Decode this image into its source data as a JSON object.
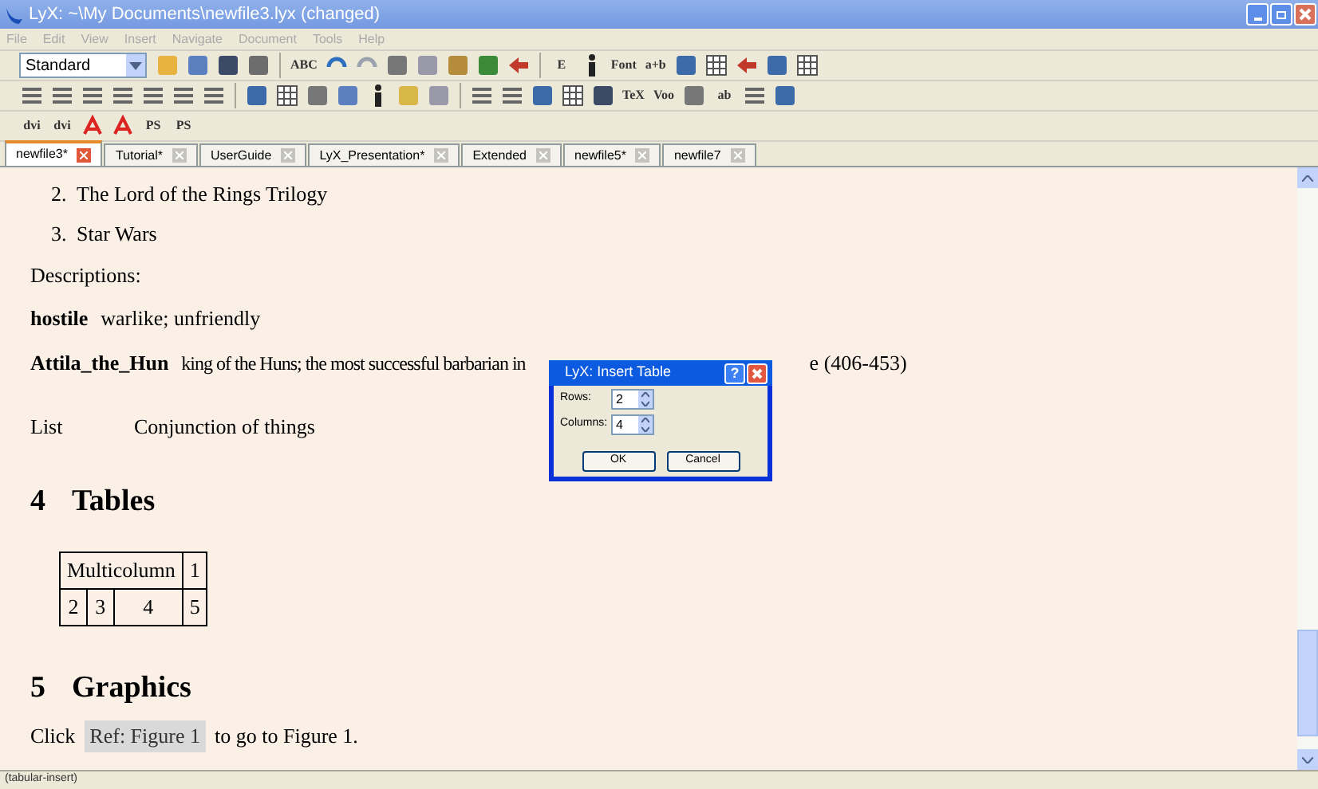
{
  "window": {
    "title": "LyX: ~\\My Documents\\newfile3.lyx (changed)"
  },
  "menu": [
    "File",
    "Edit",
    "View",
    "Insert",
    "Navigate",
    "Document",
    "Tools",
    "Help"
  ],
  "toolbars": [
    [
      {
        "kind": "combo",
        "label": "Standard"
      },
      {
        "kind": "icon"
      },
      {
        "kind": "icon"
      },
      {
        "kind": "icon"
      },
      {
        "kind": "icon"
      },
      {
        "kind": "sep"
      },
      {
        "kind": "label",
        "label": "ABC"
      },
      {
        "kind": "icon"
      },
      {
        "kind": "icon"
      },
      {
        "kind": "icon"
      },
      {
        "kind": "icon"
      },
      {
        "kind": "icon"
      },
      {
        "kind": "icon"
      },
      {
        "kind": "icon"
      },
      {
        "kind": "sep"
      },
      {
        "kind": "label",
        "label": "E"
      },
      {
        "kind": "icon"
      },
      {
        "kind": "label",
        "label": "Font"
      },
      {
        "kind": "label",
        "label": "a+b"
      },
      {
        "kind": "icon"
      },
      {
        "kind": "icon"
      },
      {
        "kind": "icon"
      },
      {
        "kind": "icon"
      },
      {
        "kind": "icon"
      }
    ],
    [
      {
        "kind": "icon"
      },
      {
        "kind": "icon"
      },
      {
        "kind": "icon"
      },
      {
        "kind": "icon"
      },
      {
        "kind": "icon"
      },
      {
        "kind": "icon"
      },
      {
        "kind": "icon"
      },
      {
        "kind": "sep"
      },
      {
        "kind": "icon"
      },
      {
        "kind": "icon"
      },
      {
        "kind": "icon"
      },
      {
        "kind": "icon"
      },
      {
        "kind": "icon"
      },
      {
        "kind": "icon"
      },
      {
        "kind": "icon"
      },
      {
        "kind": "sep"
      },
      {
        "kind": "icon"
      },
      {
        "kind": "icon"
      },
      {
        "kind": "icon"
      },
      {
        "kind": "icon"
      },
      {
        "kind": "icon"
      },
      {
        "kind": "label",
        "label": "TeX"
      },
      {
        "kind": "label",
        "label": "Voo"
      },
      {
        "kind": "icon"
      },
      {
        "kind": "label",
        "label": "ab"
      },
      {
        "kind": "icon"
      },
      {
        "kind": "icon"
      }
    ],
    [
      {
        "kind": "label",
        "label": "dvi"
      },
      {
        "kind": "label",
        "label": "dvi"
      },
      {
        "kind": "icon"
      },
      {
        "kind": "icon"
      },
      {
        "kind": "label",
        "label": "PS"
      },
      {
        "kind": "label",
        "label": "PS"
      }
    ]
  ],
  "tabs": [
    {
      "label": "newfile3*",
      "selected": true
    },
    {
      "label": "Tutorial*",
      "selected": false
    },
    {
      "label": "UserGuide",
      "selected": false
    },
    {
      "label": "LyX_Presentation*",
      "selected": false
    },
    {
      "label": "Extended",
      "selected": false
    },
    {
      "label": "newfile5*",
      "selected": false
    },
    {
      "label": "newfile7",
      "selected": false
    }
  ],
  "document": [
    {
      "kind": "enum",
      "number": "2.",
      "text": "The Lord of the Rings Trilogy"
    },
    {
      "kind": "enum",
      "number": "3.",
      "text": "Star Wars"
    },
    {
      "kind": "para",
      "text": "Descriptions:"
    },
    {
      "kind": "description",
      "term": "hostile",
      "text": "warlike; unfriendly"
    },
    {
      "kind": "description",
      "term": "Attila_the_Hun",
      "text": "king of the Huns; the most successful barbarian in",
      "text_after": "e (406-453)"
    },
    {
      "kind": "list",
      "term": "List",
      "text": "Conjunction of things"
    },
    {
      "kind": "section",
      "number": "4",
      "title": "Tables"
    },
    {
      "kind": "table",
      "rows": [
        [
          {
            "text": "Multicolumn",
            "colspan": 3
          },
          {
            "text": "1"
          }
        ],
        [
          {
            "text": "2"
          },
          {
            "text": "3"
          },
          {
            "text": "4"
          },
          {
            "text": "5"
          }
        ]
      ]
    },
    {
      "kind": "section",
      "number": "5",
      "title": "Graphics"
    },
    {
      "kind": "ref",
      "before": "Click",
      "ref": "Ref: Figure 1",
      "after": "to go to Figure 1."
    }
  ],
  "dialog": {
    "title": "LyX: Insert Table",
    "help": "?",
    "fields": [
      {
        "label": "Rows:",
        "value": "2"
      },
      {
        "label": "Columns:",
        "value": "4"
      }
    ],
    "buttons": [
      "OK",
      "Cancel"
    ]
  },
  "status_bar": "(tabular-insert)"
}
